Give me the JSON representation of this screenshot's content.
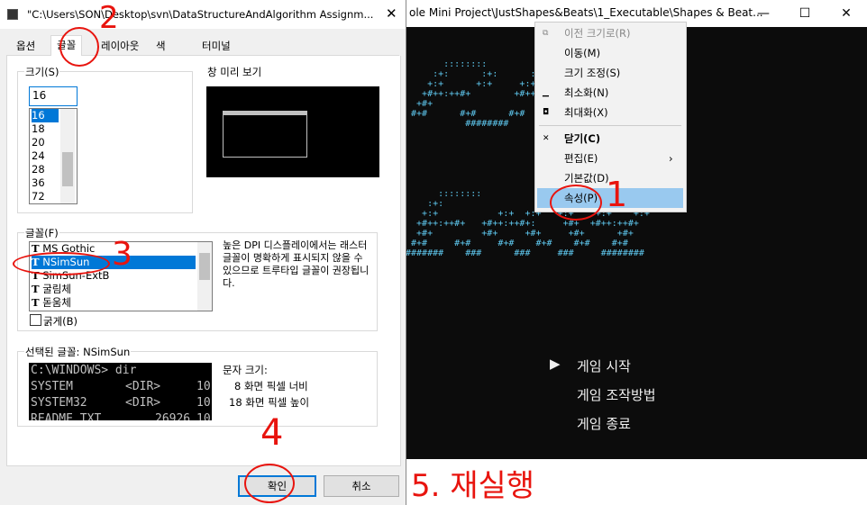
{
  "console": {
    "title": "ole Mini Project\\JustShapes&Beats\\1_Executable\\Shapes & Beat...",
    "minimize_icon": "minimize-icon",
    "maximize_icon": "maximize-icon",
    "close_icon": "close-icon",
    "ascii_art": [
      "       ::::::::               .        ::",
      "     :+:      :+:      :+:          :+:",
      "    +:+      +:+     +:+ +:+        +:+",
      "   +#++:++#+        +#++:++#+      +#++:++#+",
      "  +#+                       +#+",
      " #+#      #+#      #+#      #+#",
      "           ########"
    ],
    "ascii_art2": [
      "      ::::::::           .         ::::::::",
      "    :+:                 :+:   :+:      :+:    :+:",
      "   +:+           +:+  +:+   +:+    +:+    +:+",
      "  +#++:++#+   +#++:++#+:     +#+  +#++:++#+",
      "  +#+         +#+     +#+     +#+      +#+",
      " #+#     #+#     #+#    #+#    #+#    #+#",
      "#######    ###      ###     ###     ########"
    ],
    "menu_items": [
      "게임 시작",
      "게임 조작방법",
      "게임 종료"
    ],
    "menu_cursor": "▶"
  },
  "context_menu": {
    "items": [
      {
        "icon": "⧉",
        "label": "이전 크기로(R)",
        "disabled": true
      },
      {
        "icon": "",
        "label": "이동(M)",
        "disabled": false
      },
      {
        "icon": "",
        "label": "크기 조정(S)",
        "disabled": false
      },
      {
        "icon": "▁",
        "label": "최소화(N)",
        "disabled": false
      },
      {
        "icon": "◘",
        "label": "최대화(X)",
        "disabled": false
      },
      {
        "icon": "✕",
        "label": "닫기(C)",
        "disabled": false,
        "bold": true
      },
      {
        "icon": "",
        "label": "편집(E)",
        "disabled": false,
        "submenu": "›"
      },
      {
        "icon": "",
        "label": "기본값(D)",
        "disabled": false
      },
      {
        "icon": "",
        "label": "속성(P)",
        "disabled": false,
        "selected": true
      }
    ]
  },
  "dialog": {
    "title": "\"C:\\Users\\SON\\Desktop\\svn\\DataStructureAndAlgorithm Assignm...",
    "close_icon": "✕",
    "tabs": [
      "옵션",
      "글꼴",
      "레이아웃",
      "색",
      "터미널"
    ],
    "size_group_label": "크기(S)",
    "size_value": "16",
    "size_list": [
      "16",
      "18",
      "20",
      "24",
      "28",
      "36",
      "72"
    ],
    "preview_label": "창 미리 보기",
    "font_group_label": "글꼴(F)",
    "font_list": [
      "MS Gothic",
      "NSimSun",
      "SimSun-ExtB",
      "굴림체",
      "돋움체"
    ],
    "font_note": "높은 DPI 디스플레이에서는 래스터 글꼴이 명확하게 표시되지 않을 수 있으므로 트루타입 글꼴이 권장됩니다.",
    "bold_label": "굵게(B)",
    "selected_font_label": "선택된 글꼴: NSimSun",
    "sample_lines": [
      [
        "C:\\WINDOWS> dir",
        "",
        ""
      ],
      [
        "SYSTEM",
        "<DIR>",
        "10"
      ],
      [
        "SYSTEM32",
        "<DIR>",
        "10"
      ],
      [
        "README    TXT",
        "26926",
        "10"
      ]
    ],
    "char_size_label": "문자 크기:",
    "char_width": "8 화면 픽셀 너비",
    "char_height": "18 화면 픽셀 높이",
    "ok_label": "확인",
    "cancel_label": "취소"
  },
  "annotations": {
    "n1": "1",
    "n2": "2",
    "n3": "3",
    "n4": "4",
    "n5": "5. 재실행"
  }
}
